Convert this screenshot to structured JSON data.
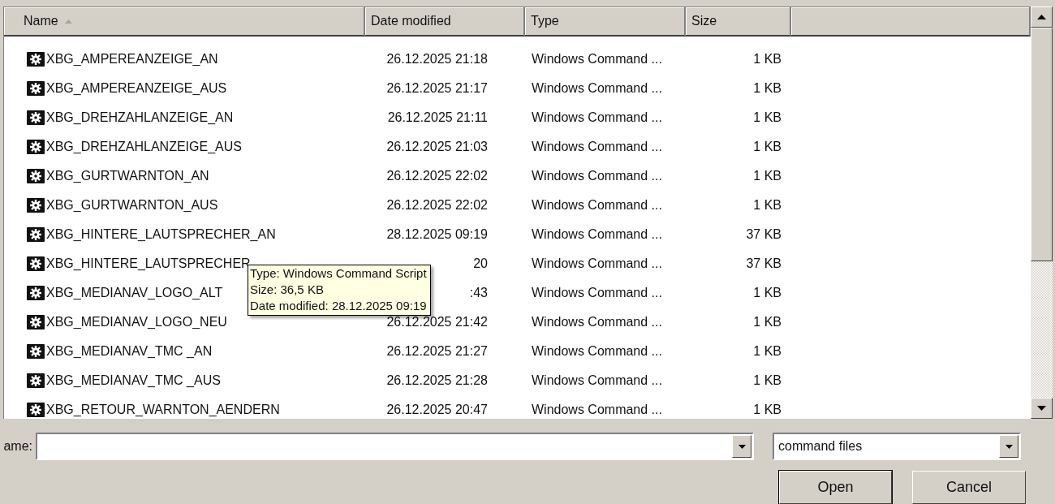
{
  "columns": [
    {
      "label": "Name",
      "sorted": true
    },
    {
      "label": "Date modified",
      "sorted": false
    },
    {
      "label": "Type",
      "sorted": false
    },
    {
      "label": "Size",
      "sorted": false
    }
  ],
  "files": [
    {
      "name": "XBG_AMPEREANZEIGE_AN",
      "date": "26.12.2025 21:18",
      "type": "Windows Command ...",
      "size": "1 KB"
    },
    {
      "name": "XBG_AMPEREANZEIGE_AUS",
      "date": "26.12.2025 21:17",
      "type": "Windows Command ...",
      "size": "1 KB"
    },
    {
      "name": "XBG_DREHZAHLANZEIGE_AN",
      "date": "26.12.2025 21:11",
      "type": "Windows Command ...",
      "size": "1 KB"
    },
    {
      "name": "XBG_DREHZAHLANZEIGE_AUS",
      "date": "26.12.2025 21:03",
      "type": "Windows Command ...",
      "size": "1 KB"
    },
    {
      "name": "XBG_GURTWARNTON_AN",
      "date": "26.12.2025 22:02",
      "type": "Windows Command ...",
      "size": "1 KB"
    },
    {
      "name": "XBG_GURTWARNTON_AUS",
      "date": "26.12.2025 22:02",
      "type": "Windows Command ...",
      "size": "1 KB"
    },
    {
      "name": "XBG_HINTERE_LAUTSPRECHER_AN",
      "date": "28.12.2025 09:19",
      "type": "Windows Command ...",
      "size": "37 KB"
    },
    {
      "name": "XBG_HINTERE_LAUTSPRECHER",
      "date": "20",
      "type": "Windows Command ...",
      "size": "37 KB"
    },
    {
      "name": "XBG_MEDIANAV_LOGO_ALT",
      "date": ":43",
      "type": "Windows Command ...",
      "size": "1 KB"
    },
    {
      "name": "XBG_MEDIANAV_LOGO_NEU",
      "date": "26.12.2025 21:42",
      "type": "Windows Command ...",
      "size": "1 KB"
    },
    {
      "name": "XBG_MEDIANAV_TMC _AN",
      "date": "26.12.2025 21:27",
      "type": "Windows Command ...",
      "size": "1 KB"
    },
    {
      "name": "XBG_MEDIANAV_TMC _AUS",
      "date": "26.12.2025 21:28",
      "type": "Windows Command ...",
      "size": "1 KB"
    },
    {
      "name": "XBG_RETOUR_WARNTON_AENDERN",
      "date": "26.12.2025 20:47",
      "type": "Windows Command ...",
      "size": "1 KB"
    }
  ],
  "tooltip": {
    "lines": [
      "Type: Windows Command Script",
      "Size: 36,5 KB",
      "Date modified: 28.12.2025 09:19"
    ]
  },
  "filename": {
    "label": "ame:"
  },
  "filetype": "command files",
  "buttons": [
    "Open",
    "Cancel"
  ]
}
